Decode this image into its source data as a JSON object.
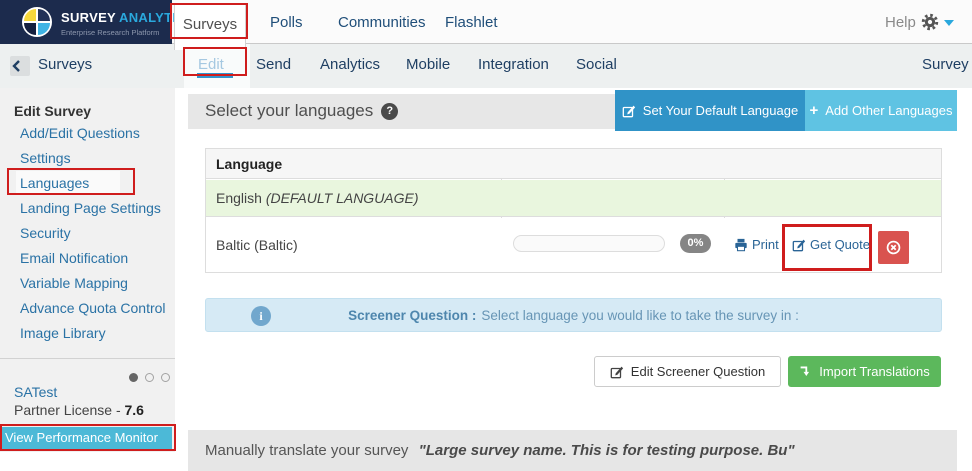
{
  "topnav": {
    "brand": {
      "name_a": "SURVEY",
      "name_b": "ANALYTICS",
      "tagline": "Enterprise Research Platform"
    },
    "tabs": [
      "Surveys",
      "Polls",
      "Communities",
      "Flashlet"
    ],
    "help": "Help"
  },
  "subnav": {
    "back": "Surveys",
    "tabs": [
      "Edit",
      "Send",
      "Analytics",
      "Mobile",
      "Integration",
      "Social"
    ],
    "active_tab": "Edit",
    "right_label": "Survey"
  },
  "sidebar": {
    "heading": "Edit Survey",
    "items": [
      "Add/Edit Questions",
      "Settings",
      "Languages",
      "Landing Page Settings",
      "Security",
      "Email Notification",
      "Variable Mapping",
      "Advance Quota Control",
      "Image Library"
    ],
    "active_item": "Languages",
    "footer": {
      "account": "SATest",
      "license_label": "Partner License -",
      "license_value": "7.6",
      "monitor": "View Performance Monitor"
    }
  },
  "panel": {
    "title": "Select your languages",
    "help_glyph": "?",
    "buttons": {
      "set_default": "Set Your Default Language",
      "add_other": "Add Other Languages",
      "plus": "+"
    },
    "table": {
      "header": "Language",
      "default_row": {
        "name": "English",
        "tag": "(DEFAULT LANGUAGE)"
      },
      "lang_row": {
        "name": "Baltic (Baltic)",
        "progress": "0%",
        "print": "Print",
        "quote": "Get Quote"
      }
    },
    "info": {
      "bold": "Screener Question :",
      "text": "Select language you would like to take the survey in :",
      "glyph": "i"
    },
    "actions": {
      "edit_screener": "Edit Screener Question",
      "import": "Import Translations"
    },
    "footer": {
      "prefix": "Manually translate your survey",
      "survey_name": "\"Large survey name. This is for testing purpose. Bu\""
    }
  },
  "colors": {
    "navy": "#1c2b4d",
    "brand_blue": "#2aa8dd",
    "nav_text": "#1f4e79",
    "button_blue": "#3093c7",
    "button_lightblue": "#5fc3e3",
    "green_button": "#5cb85c",
    "delete_red": "#d9534f",
    "annotation_red": "#cf1d1d",
    "monitor_cyan": "#4cb9d7",
    "default_row_green": "#e9f6de",
    "info_bar_blue": "#d6eaf5",
    "link_blue": "#2a6496"
  },
  "icons": {
    "gear": "gear-icon",
    "caret": "caret-down-icon",
    "back": "chevron-left-icon",
    "question": "question-circle-icon",
    "pencil": "pencil-square-icon",
    "plus": "plus-icon",
    "printer": "printer-icon",
    "delete": "circled-x-icon",
    "info": "info-circle-icon",
    "import": "level-down-arrow-icon"
  }
}
